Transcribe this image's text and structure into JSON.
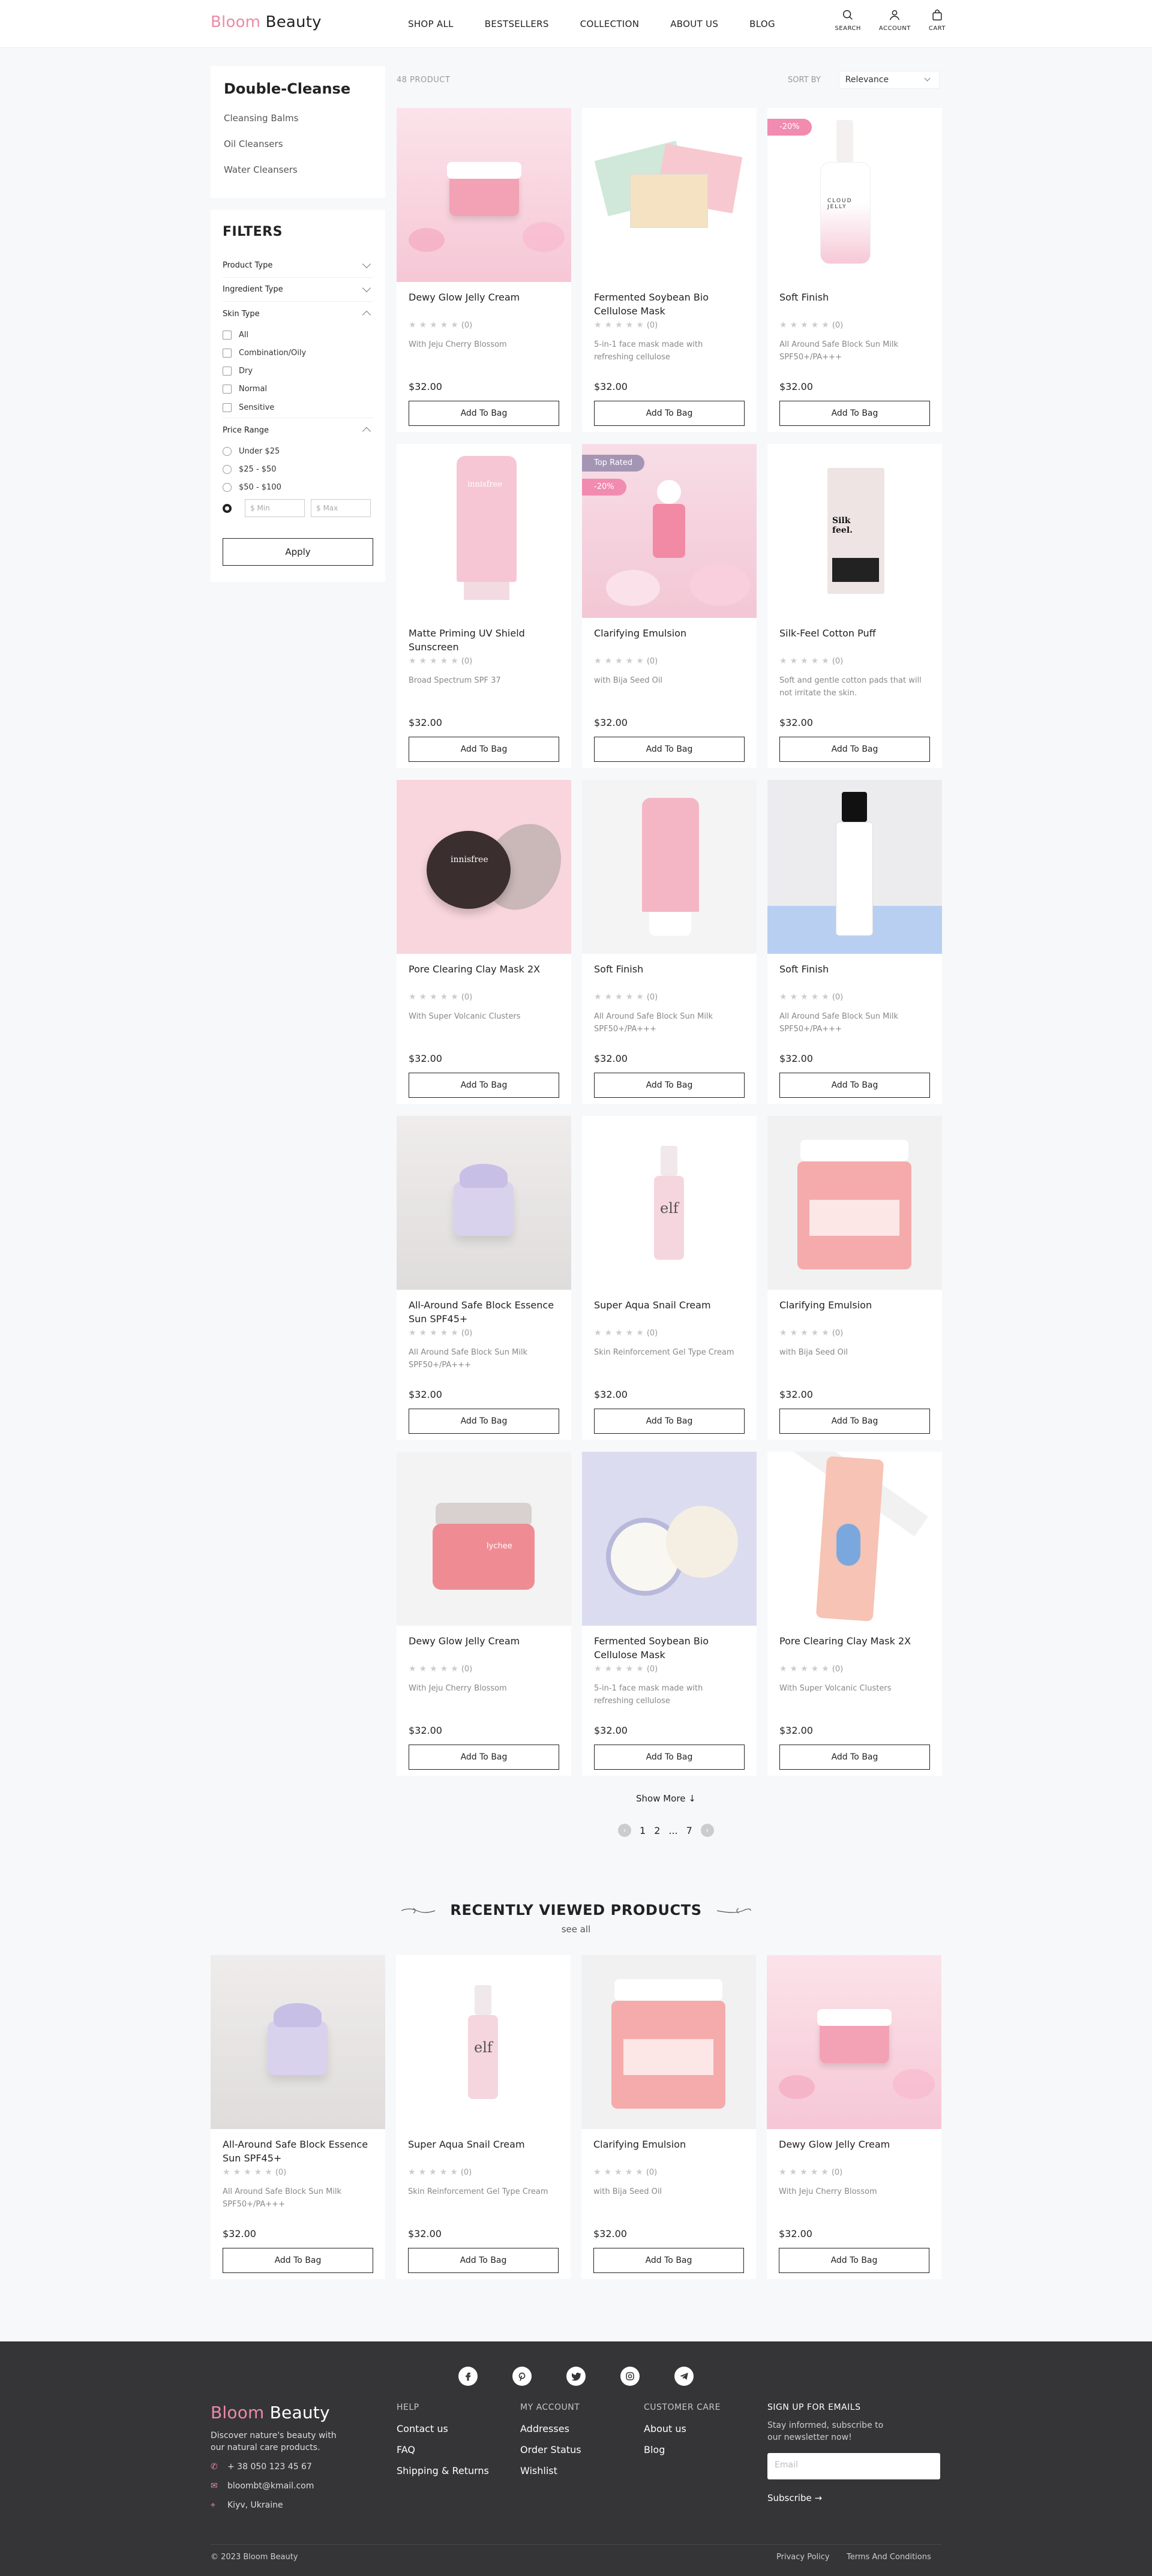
{
  "header": {
    "brand_a": "Bloom",
    "brand_b": "Beauty",
    "nav": [
      "SHOP ALL",
      "BESTSELLERS",
      "COLLECTION",
      "ABOUT US",
      "BLOG"
    ],
    "icons": {
      "search": "SEARCH",
      "account": "ACCOUNT",
      "cart": "CART"
    }
  },
  "category": {
    "title": "Double-Cleanse",
    "links": [
      "Cleansing Balms",
      "Oil Cleansers",
      "Water Cleansers"
    ]
  },
  "filters": {
    "title": "FILTERS",
    "product_type": "Product Type",
    "ingredient_type": "Ingredient Type",
    "skin_type": "Skin Type",
    "skin_options": [
      "All",
      "Combination/Oily",
      "Dry",
      "Normal",
      "Sensitive"
    ],
    "price_range": "Price Range",
    "price_options": [
      "Under $25",
      "$25 - $50",
      "$50 - $100"
    ],
    "min_placeholder": "$  Min",
    "max_placeholder": "$  Max",
    "apply": "Apply"
  },
  "listing": {
    "count": "48 PRODUCT",
    "sort_label": "SORT BY",
    "sort_value": "Relevance"
  },
  "products": [
    {
      "name": "Dewy Glow Jelly Cream",
      "reviews": "(0)",
      "desc": "With Jeju Cherry Blossom",
      "price": "$32.00",
      "button": "Add To Bag",
      "img": "jelly-cream",
      "badge": ""
    },
    {
      "name": "Fermented Soybean Bio Cellulose Mask",
      "reviews": "(0)",
      "desc": "5-in-1 face mask made with refreshing cellulose",
      "price": "$32.00",
      "button": "Add To Bag",
      "img": "sheet-mask",
      "badge": ""
    },
    {
      "name": "Soft Finish",
      "reviews": "(0)",
      "desc": "All Around Safe Block Sun Milk SPF50+/PA+++",
      "price": "$32.00",
      "button": "Add To Bag",
      "img": "cloud-jelly",
      "badge": "-20%"
    },
    {
      "name": "Matte Priming UV Shield Sunscreen",
      "reviews": "(0)",
      "desc": "Broad Spectrum SPF 37",
      "price": "$32.00",
      "button": "Add To Bag",
      "img": "uv-tube",
      "badge": ""
    },
    {
      "name": "Clarifying Emulsion",
      "reviews": "(0)",
      "desc": "with Bija Seed Oil",
      "price": "$32.00",
      "button": "Add To Bag",
      "img": "dropper",
      "badge": "-20%",
      "badge_top": "Top Rated"
    },
    {
      "name": "Silk-Feel Cotton Puff",
      "reviews": "(0)",
      "desc": "Soft and gentle cotton pads that will not irritate the skin.",
      "price": "$32.00",
      "button": "Add To Bag",
      "img": "cotton-puff",
      "badge": ""
    },
    {
      "name": "Pore Clearing Clay Mask 2X",
      "reviews": "(0)",
      "desc": "With Super Volcanic Clusters",
      "price": "$32.00",
      "button": "Add To Bag",
      "img": "clay-jar",
      "badge": ""
    },
    {
      "name": "Soft Finish",
      "reviews": "(0)",
      "desc": "All Around Safe Block Sun Milk SPF50+/PA+++",
      "price": "$32.00",
      "button": "Add To Bag",
      "img": "pink-tube",
      "badge": ""
    },
    {
      "name": "Soft Finish",
      "reviews": "(0)",
      "desc": "All Around Safe Block Sun Milk SPF50+/PA+++",
      "price": "$32.00",
      "button": "Add To Bag",
      "img": "essence-bottle",
      "badge": ""
    },
    {
      "name": "All-Around Safe Block Essence Sun SPF45+",
      "reviews": "(0)",
      "desc": "All Around Safe Block Sun Milk SPF50+/PA+++",
      "price": "$32.00",
      "button": "Add To Bag",
      "img": "lavender-jar",
      "badge": ""
    },
    {
      "name": "Super Aqua Snail Cream",
      "reviews": "(0)",
      "desc": "Skin Reinforcement Gel Type Cream",
      "price": "$32.00",
      "button": "Add To Bag",
      "img": "elf-bottle",
      "badge": ""
    },
    {
      "name": "Clarifying Emulsion",
      "reviews": "(0)",
      "desc": "with Bija Seed Oil",
      "price": "$32.00",
      "button": "Add To Bag",
      "img": "salt-tub",
      "badge": ""
    },
    {
      "name": "Dewy Glow Jelly Cream",
      "reviews": "(0)",
      "desc": "With Jeju Cherry Blossom",
      "price": "$32.00",
      "button": "Add To Bag",
      "img": "lychee-jar",
      "badge": ""
    },
    {
      "name": "Fermented Soybean Bio Cellulose Mask",
      "reviews": "(0)",
      "desc": "5-in-1 face mask made with refreshing cellulose",
      "price": "$32.00",
      "button": "Add To Bag",
      "img": "powder-compact",
      "badge": ""
    },
    {
      "name": "Pore Clearing Clay Mask 2X",
      "reviews": "(0)",
      "desc": "With Super Volcanic Clusters",
      "price": "$32.00",
      "button": "Add To Bag",
      "img": "cartoon-tube",
      "badge": ""
    }
  ],
  "pagination": {
    "show_more": "Show More ↓",
    "pages": [
      "1",
      "2",
      "...",
      "7"
    ]
  },
  "recent": {
    "title": "RECENTLY VIEWED PRODUCTS",
    "see_all": "see all",
    "items": [
      {
        "name": "All-Around Safe Block Essence Sun SPF45+",
        "reviews": "(0)",
        "desc": "All Around Safe Block Sun Milk SPF50+/PA+++",
        "price": "$32.00",
        "button": "Add To Bag",
        "img": "lavender-jar"
      },
      {
        "name": "Super Aqua Snail Cream",
        "reviews": "(0)",
        "desc": "Skin Reinforcement Gel Type Cream",
        "price": "$32.00",
        "button": "Add To Bag",
        "img": "elf-bottle"
      },
      {
        "name": "Clarifying Emulsion",
        "reviews": "(0)",
        "desc": "with Bija Seed Oil",
        "price": "$32.00",
        "button": "Add To Bag",
        "img": "salt-tub"
      },
      {
        "name": "Dewy Glow Jelly Cream",
        "reviews": "(0)",
        "desc": "With Jeju Cherry Blossom",
        "price": "$32.00",
        "button": "Add To Bag",
        "img": "jelly-cream"
      }
    ]
  },
  "footer": {
    "brand_a": "Bloom",
    "brand_b": "Beauty",
    "tagline": "Discover nature's beauty with our natural care products.",
    "phone": "+ 38 050 123 45 67",
    "email": "bloombt@kmail.com",
    "location": "Kiyv, Ukraine",
    "help_title": "HELP",
    "help": [
      "Contact us",
      "FAQ",
      "Shipping & Returns"
    ],
    "account_title": "MY ACCOUNT",
    "account": [
      "Addresses",
      "Order Status",
      "Wishlist"
    ],
    "care_title": "CUSTOMER CARE",
    "care": [
      "About us",
      "Blog"
    ],
    "signup_title": "SIGN UP FOR EMAILS",
    "signup_text": "Stay informed, subscribe to our newsletter now!",
    "email_placeholder": "Email",
    "subscribe": "Subscribe →",
    "copyright": "© 2023 Bloom Beauty",
    "privacy": "Privacy Policy",
    "terms": "Terms And Conditions",
    "social": [
      "facebook-icon",
      "pinterest-icon",
      "twitter-icon",
      "instagram-icon",
      "telegram-icon"
    ]
  },
  "colors": {
    "brand_pink": "#ec8aa6",
    "sale_badge": "#f28bb0",
    "top_badge": "#a495b5",
    "footer_bg": "#353537"
  }
}
